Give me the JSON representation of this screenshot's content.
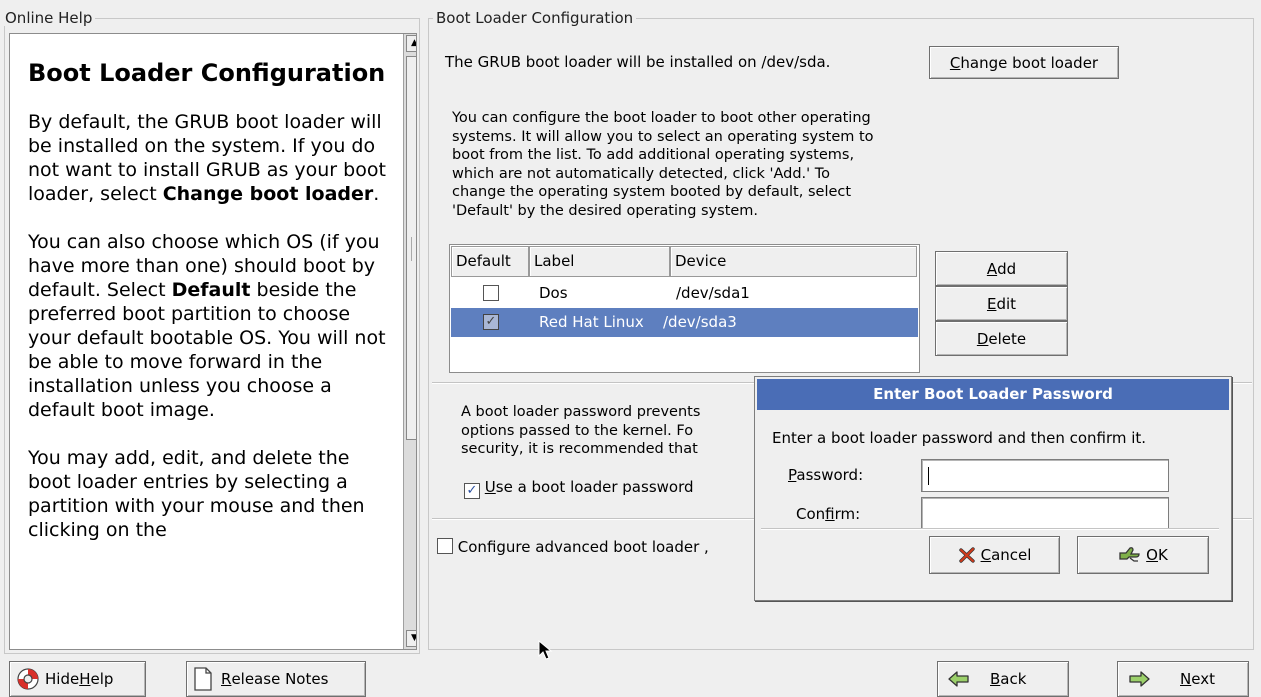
{
  "help": {
    "group_title": "Online Help",
    "heading": "Boot Loader Configuration",
    "p1_pre": "By default, the GRUB boot loader will be installed on the system. If you do not want to install GRUB as your boot loader, select ",
    "p1_bold": "Change boot loader",
    "p1_post": ".",
    "p2_pre": "You can also choose which OS (if you have more than one) should boot by default. Select ",
    "p2_bold": "Default",
    "p2_post": " beside the preferred boot partition to choose your default bootable OS. You will not be able to move forward in the installation unless you choose a default boot image.",
    "p3": "You may add, edit, and delete the boot loader entries by selecting a partition with your mouse and then clicking on the"
  },
  "config": {
    "group_title": "Boot Loader Configuration",
    "install_text": "The GRUB boot loader will be installed on /dev/sda.",
    "change_button": {
      "mnemonic": "C",
      "rest": "hange boot loader"
    },
    "desc_lines": [
      "You can configure the boot loader to boot other operating",
      "systems. It will allow you to select an operating system to",
      "boot from the list. To add additional operating systems,",
      "which are not automatically detected, click 'Add.' To",
      "change the operating system booted by default, select",
      "'Default' by the desired operating system."
    ],
    "table": {
      "headers": [
        "Default",
        "Label",
        "Device"
      ],
      "rows": [
        {
          "default": false,
          "label": "Dos",
          "device": "/dev/sda1",
          "selected": false
        },
        {
          "default": true,
          "label": "Red Hat Linux",
          "device": "/dev/sda3",
          "selected": true
        }
      ]
    },
    "add_button": {
      "mnemonic": "A",
      "rest": "dd"
    },
    "edit_button": {
      "mnemonic": "E",
      "rest": "dit"
    },
    "delete_button": {
      "mnemonic": "D",
      "rest": "elete"
    },
    "password_desc_lines": [
      "A boot loader password prevents",
      "options passed to the kernel.  Fo",
      "security, it is recommended that"
    ],
    "use_password": {
      "checked": true,
      "mnemonic": "U",
      "rest": "se a boot loader password"
    },
    "advanced": {
      "checked": false,
      "label": "Configure advanced boot loader ,"
    }
  },
  "dialog": {
    "title": "Enter Boot Loader Password",
    "prompt": "Enter a boot loader password and then confirm it.",
    "password_label": {
      "mnemonic": "P",
      "rest": "assword:"
    },
    "confirm_label": {
      "pre": "Con",
      "mnemonic": "f",
      "rest": "irm:"
    },
    "password_value": "",
    "confirm_value": "",
    "cancel": {
      "mnemonic": "C",
      "rest": "ancel"
    },
    "ok": {
      "mnemonic": "O",
      "rest": "K"
    }
  },
  "bottom": {
    "hide_help": {
      "pre": "Hide ",
      "mnemonic": "H",
      "rest": "elp"
    },
    "release_notes": {
      "mnemonic": "R",
      "rest": "elease Notes"
    },
    "back": {
      "mnemonic": "B",
      "rest": "ack"
    },
    "next": {
      "mnemonic": "N",
      "rest": "ext"
    }
  },
  "icons": [
    "lifebuoy-icon",
    "document-icon",
    "back-arrow-icon",
    "next-arrow-icon",
    "cancel-x-icon",
    "ok-hand-icon",
    "mouse-cursor-icon"
  ],
  "colors": {
    "selection": "#5e7fbf",
    "dialog_title": "#4a6db6",
    "window_bg": "#efefef"
  }
}
